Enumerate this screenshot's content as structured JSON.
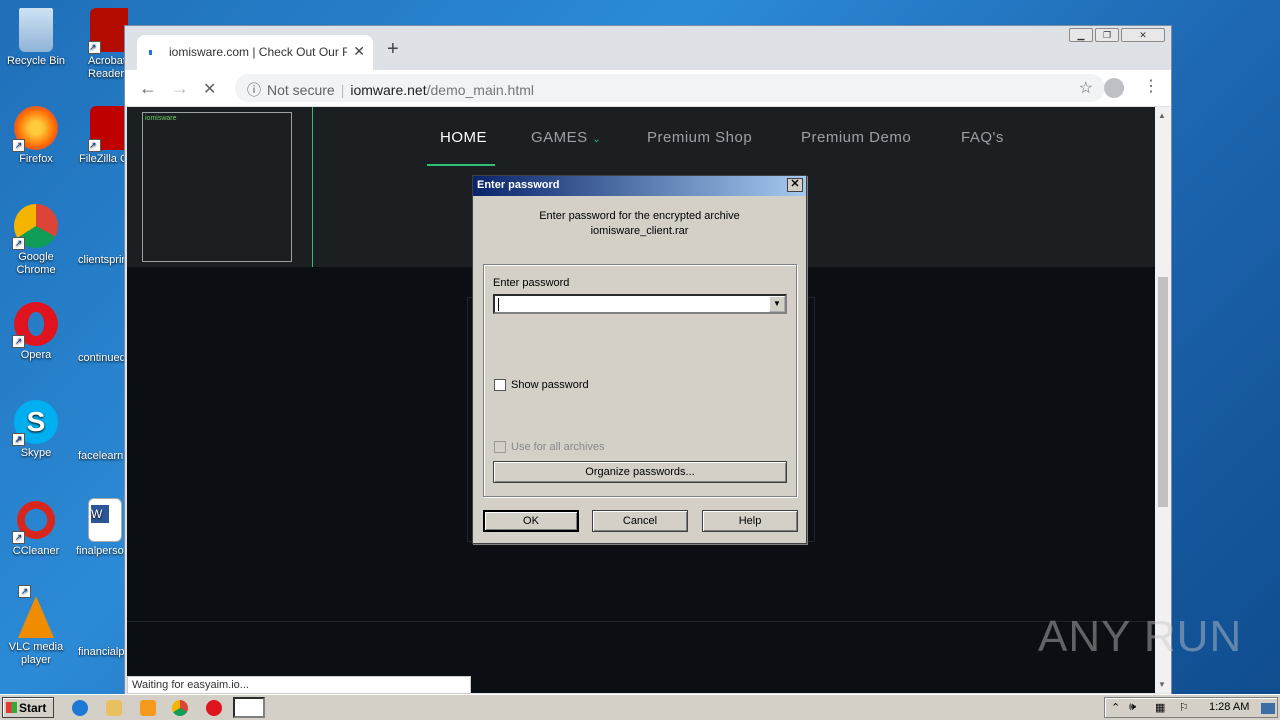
{
  "desktop": {
    "icons": [
      {
        "label": "Recycle Bin"
      },
      {
        "label": "Acrobat Reader"
      },
      {
        "label": "Firefox"
      },
      {
        "label": "FileZilla C"
      },
      {
        "label": "Google Chrome"
      },
      {
        "label": "clientsprin"
      },
      {
        "label": "Opera"
      },
      {
        "label": "continued"
      },
      {
        "label": "Skype"
      },
      {
        "label": "facelearn"
      },
      {
        "label": "CCleaner"
      },
      {
        "label": "finalperso"
      },
      {
        "label": "VLC media player"
      },
      {
        "label": "financialp"
      }
    ]
  },
  "browser": {
    "tab_title": "iomisware.com | Check Out Our Ran",
    "url_status": "Not secure",
    "url_domain": "iomware.net",
    "url_path": "/demo_main.html",
    "status_text": "Waiting for easyaim.io..."
  },
  "site": {
    "logo_alt": "iomisware",
    "nav": {
      "home": "HOME",
      "games": "GAMES",
      "shop": "Premium Shop",
      "demo": "Premium Demo",
      "faq": "FAQ's"
    }
  },
  "dialog": {
    "title": "Enter password",
    "message_line1": "Enter password for the encrypted archive",
    "message_line2": "iomisware_client.rar",
    "password_label": "Enter password",
    "show_password": "Show password",
    "use_for_all": "Use for all archives",
    "organize": "Organize passwords...",
    "ok": "OK",
    "cancel": "Cancel",
    "help": "Help"
  },
  "watermark": "ANY RUN",
  "taskbar": {
    "start": "Start",
    "clock": "1:28 AM"
  }
}
